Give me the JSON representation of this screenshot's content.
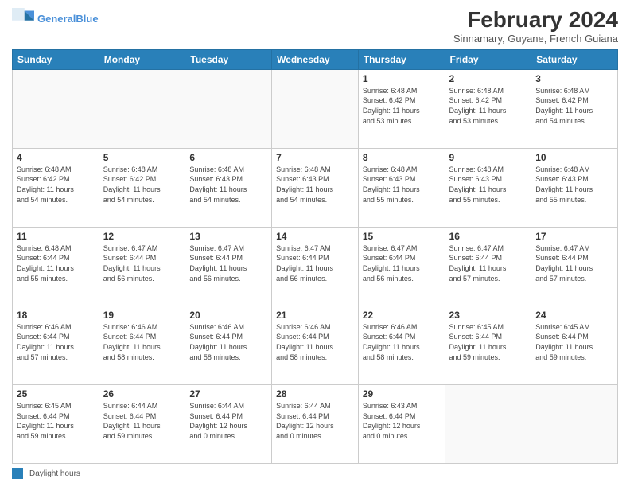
{
  "header": {
    "logo_line1": "General",
    "logo_line2": "Blue",
    "main_title": "February 2024",
    "sub_title": "Sinnamary, Guyane, French Guiana"
  },
  "weekdays": [
    "Sunday",
    "Monday",
    "Tuesday",
    "Wednesday",
    "Thursday",
    "Friday",
    "Saturday"
  ],
  "weeks": [
    [
      {
        "day": "",
        "info": ""
      },
      {
        "day": "",
        "info": ""
      },
      {
        "day": "",
        "info": ""
      },
      {
        "day": "",
        "info": ""
      },
      {
        "day": "1",
        "info": "Sunrise: 6:48 AM\nSunset: 6:42 PM\nDaylight: 11 hours\nand 53 minutes."
      },
      {
        "day": "2",
        "info": "Sunrise: 6:48 AM\nSunset: 6:42 PM\nDaylight: 11 hours\nand 53 minutes."
      },
      {
        "day": "3",
        "info": "Sunrise: 6:48 AM\nSunset: 6:42 PM\nDaylight: 11 hours\nand 54 minutes."
      }
    ],
    [
      {
        "day": "4",
        "info": "Sunrise: 6:48 AM\nSunset: 6:42 PM\nDaylight: 11 hours\nand 54 minutes."
      },
      {
        "day": "5",
        "info": "Sunrise: 6:48 AM\nSunset: 6:42 PM\nDaylight: 11 hours\nand 54 minutes."
      },
      {
        "day": "6",
        "info": "Sunrise: 6:48 AM\nSunset: 6:43 PM\nDaylight: 11 hours\nand 54 minutes."
      },
      {
        "day": "7",
        "info": "Sunrise: 6:48 AM\nSunset: 6:43 PM\nDaylight: 11 hours\nand 54 minutes."
      },
      {
        "day": "8",
        "info": "Sunrise: 6:48 AM\nSunset: 6:43 PM\nDaylight: 11 hours\nand 55 minutes."
      },
      {
        "day": "9",
        "info": "Sunrise: 6:48 AM\nSunset: 6:43 PM\nDaylight: 11 hours\nand 55 minutes."
      },
      {
        "day": "10",
        "info": "Sunrise: 6:48 AM\nSunset: 6:43 PM\nDaylight: 11 hours\nand 55 minutes."
      }
    ],
    [
      {
        "day": "11",
        "info": "Sunrise: 6:48 AM\nSunset: 6:44 PM\nDaylight: 11 hours\nand 55 minutes."
      },
      {
        "day": "12",
        "info": "Sunrise: 6:47 AM\nSunset: 6:44 PM\nDaylight: 11 hours\nand 56 minutes."
      },
      {
        "day": "13",
        "info": "Sunrise: 6:47 AM\nSunset: 6:44 PM\nDaylight: 11 hours\nand 56 minutes."
      },
      {
        "day": "14",
        "info": "Sunrise: 6:47 AM\nSunset: 6:44 PM\nDaylight: 11 hours\nand 56 minutes."
      },
      {
        "day": "15",
        "info": "Sunrise: 6:47 AM\nSunset: 6:44 PM\nDaylight: 11 hours\nand 56 minutes."
      },
      {
        "day": "16",
        "info": "Sunrise: 6:47 AM\nSunset: 6:44 PM\nDaylight: 11 hours\nand 57 minutes."
      },
      {
        "day": "17",
        "info": "Sunrise: 6:47 AM\nSunset: 6:44 PM\nDaylight: 11 hours\nand 57 minutes."
      }
    ],
    [
      {
        "day": "18",
        "info": "Sunrise: 6:46 AM\nSunset: 6:44 PM\nDaylight: 11 hours\nand 57 minutes."
      },
      {
        "day": "19",
        "info": "Sunrise: 6:46 AM\nSunset: 6:44 PM\nDaylight: 11 hours\nand 58 minutes."
      },
      {
        "day": "20",
        "info": "Sunrise: 6:46 AM\nSunset: 6:44 PM\nDaylight: 11 hours\nand 58 minutes."
      },
      {
        "day": "21",
        "info": "Sunrise: 6:46 AM\nSunset: 6:44 PM\nDaylight: 11 hours\nand 58 minutes."
      },
      {
        "day": "22",
        "info": "Sunrise: 6:46 AM\nSunset: 6:44 PM\nDaylight: 11 hours\nand 58 minutes."
      },
      {
        "day": "23",
        "info": "Sunrise: 6:45 AM\nSunset: 6:44 PM\nDaylight: 11 hours\nand 59 minutes."
      },
      {
        "day": "24",
        "info": "Sunrise: 6:45 AM\nSunset: 6:44 PM\nDaylight: 11 hours\nand 59 minutes."
      }
    ],
    [
      {
        "day": "25",
        "info": "Sunrise: 6:45 AM\nSunset: 6:44 PM\nDaylight: 11 hours\nand 59 minutes."
      },
      {
        "day": "26",
        "info": "Sunrise: 6:44 AM\nSunset: 6:44 PM\nDaylight: 11 hours\nand 59 minutes."
      },
      {
        "day": "27",
        "info": "Sunrise: 6:44 AM\nSunset: 6:44 PM\nDaylight: 12 hours\nand 0 minutes."
      },
      {
        "day": "28",
        "info": "Sunrise: 6:44 AM\nSunset: 6:44 PM\nDaylight: 12 hours\nand 0 minutes."
      },
      {
        "day": "29",
        "info": "Sunrise: 6:43 AM\nSunset: 6:44 PM\nDaylight: 12 hours\nand 0 minutes."
      },
      {
        "day": "",
        "info": ""
      },
      {
        "day": "",
        "info": ""
      }
    ]
  ],
  "legend": {
    "box_label": "Daylight hours"
  }
}
